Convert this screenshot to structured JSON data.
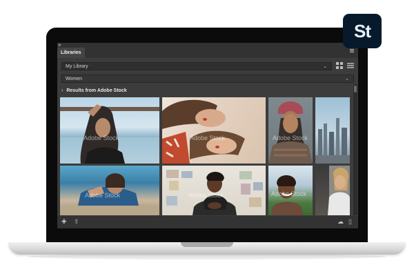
{
  "badge": {
    "label": "St"
  },
  "panel": {
    "close_glyph": "×",
    "tab_label": "Libraries",
    "library_select": {
      "value": "My Library"
    },
    "search": {
      "value": "Women"
    },
    "results_heading": "Results from Adobe Stock"
  },
  "photos": {
    "watermark": "Adobe Stock",
    "items": [
      {
        "subject": "woman at pier railing"
      },
      {
        "subject": "two women lying down"
      },
      {
        "subject": "woman in beanie"
      },
      {
        "subject": "city skyline"
      },
      {
        "subject": "woman lying on beach"
      },
      {
        "subject": "businesswoman at desk"
      },
      {
        "subject": "smiling woman at field"
      },
      {
        "subject": "woman at window"
      }
    ]
  },
  "icons": [
    "close-icon",
    "panel-menu-icon",
    "chevron-down-icon",
    "grid-view-icon",
    "list-view-icon",
    "chevron-right-icon",
    "add-icon",
    "upload-icon",
    "creative-cloud-icon",
    "trash-icon"
  ]
}
